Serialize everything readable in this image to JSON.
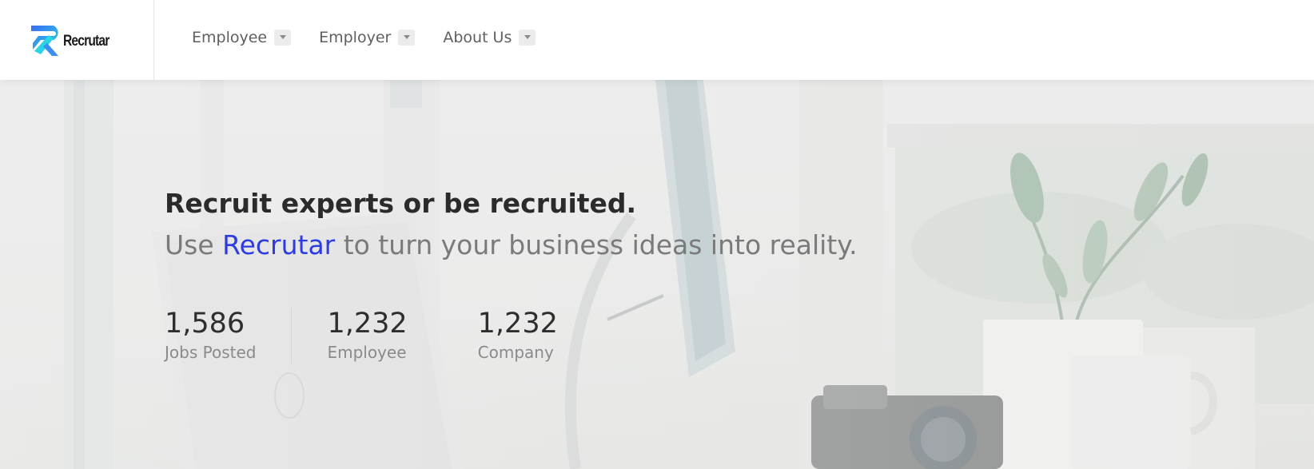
{
  "brand": {
    "name": "Recrutar",
    "logo_icon": "recrutar-r-logo-icon",
    "logo_colors": [
      "#3a6cf2",
      "#2ad3e6"
    ]
  },
  "nav": {
    "items": [
      {
        "label": "Employee",
        "icon": "chevron-down-icon"
      },
      {
        "label": "Employer",
        "icon": "chevron-down-icon"
      },
      {
        "label": "About Us",
        "icon": "chevron-down-icon"
      }
    ]
  },
  "hero": {
    "title": "Recruit experts or be recruited.",
    "subtitle_prefix": "Use ",
    "subtitle_brand": "Recrutar",
    "subtitle_suffix": " to turn your business ideas into reality.",
    "accent_color": "#2d3be0"
  },
  "stats": [
    {
      "value": "1,586",
      "label": "Jobs Posted"
    },
    {
      "value": "1,232",
      "label": "Employee"
    },
    {
      "value": "1,232",
      "label": "Company"
    }
  ]
}
